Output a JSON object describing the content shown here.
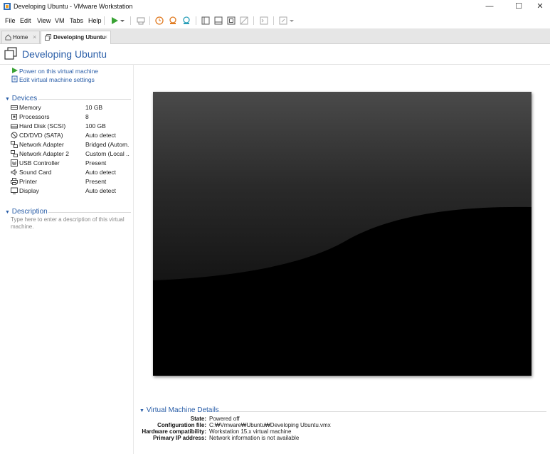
{
  "window": {
    "title": "Developing Ubuntu - VMware Workstation"
  },
  "menu": [
    "File",
    "Edit",
    "View",
    "VM",
    "Tabs",
    "Help"
  ],
  "tabs": [
    {
      "label": "Home",
      "active": false
    },
    {
      "label": "Developing Ubuntu",
      "active": true
    }
  ],
  "vm": {
    "name": "Developing Ubuntu"
  },
  "actions": {
    "power_on": "Power on this virtual machine",
    "edit_settings": "Edit virtual machine settings"
  },
  "devices": {
    "header": "Devices",
    "items": [
      {
        "name": "Memory",
        "value": "10 GB",
        "icon": "memory-icon"
      },
      {
        "name": "Processors",
        "value": "8",
        "icon": "processor-icon"
      },
      {
        "name": "Hard Disk (SCSI)",
        "value": "100 GB",
        "icon": "hard-disk-icon"
      },
      {
        "name": "CD/DVD (SATA)",
        "value": "Auto detect",
        "icon": "cd-dvd-icon"
      },
      {
        "name": "Network Adapter",
        "value": "Bridged (Autom...",
        "icon": "network-adapter-icon"
      },
      {
        "name": "Network Adapter 2",
        "value": "Custom (Local ...",
        "icon": "network-adapter-icon"
      },
      {
        "name": "USB Controller",
        "value": "Present",
        "icon": "usb-icon"
      },
      {
        "name": "Sound Card",
        "value": "Auto detect",
        "icon": "speaker-icon"
      },
      {
        "name": "Printer",
        "value": "Present",
        "icon": "printer-icon"
      },
      {
        "name": "Display",
        "value": "Auto detect",
        "icon": "display-icon"
      }
    ]
  },
  "description": {
    "header": "Description",
    "placeholder": "Type here to enter a description of this virtual machine."
  },
  "details": {
    "header": "Virtual Machine Details",
    "rows": [
      {
        "label": "State:",
        "value": "Powered off"
      },
      {
        "label": "Configuration file:",
        "value": "C:₩Vmware₩Ubuntu₩Developing Ubuntu.vmx"
      },
      {
        "label": "Hardware compatibility:",
        "value": "Workstation 15.x virtual machine"
      },
      {
        "label": "Primary IP address:",
        "value": "Network information is not available"
      }
    ]
  },
  "colors": {
    "accent": "#2a5ea8",
    "play_green": "#3aa335"
  }
}
